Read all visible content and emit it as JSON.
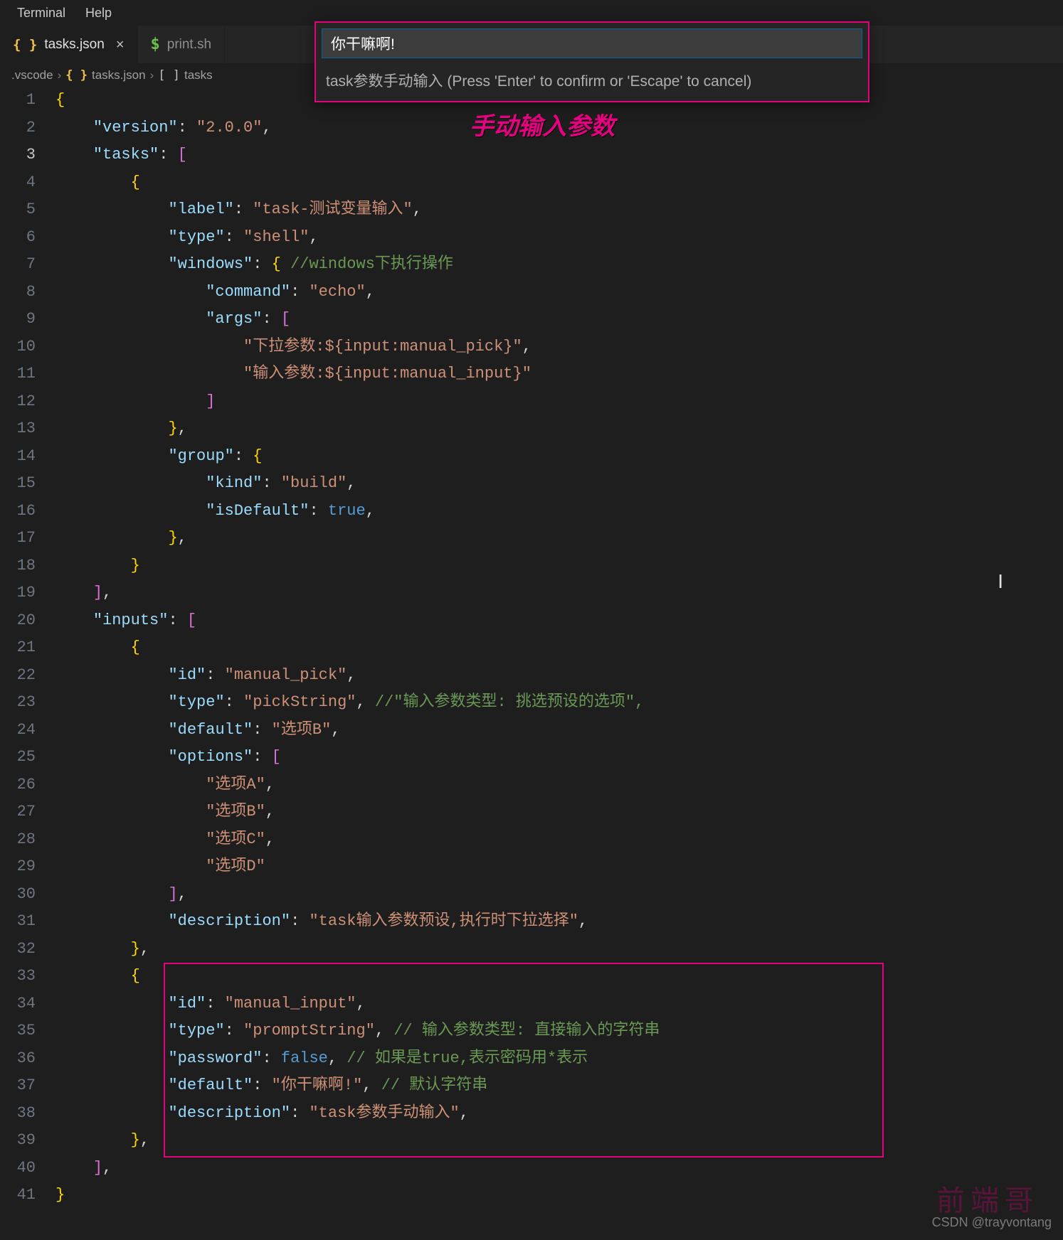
{
  "menubar": {
    "terminal": "Terminal",
    "help": "Help"
  },
  "tabs": [
    {
      "label": "tasks.json",
      "icon": "{ }",
      "active": true,
      "closable": true
    },
    {
      "label": "print.sh",
      "icon": "$",
      "active": false,
      "closable": false
    }
  ],
  "breadcrumbs": {
    "seg1": ".vscode",
    "seg2_icon": "{ }",
    "seg2": "tasks.json",
    "seg3_icon": "[ ]",
    "seg3": "tasks"
  },
  "popup": {
    "value": "你干嘛啊!",
    "hint": "task参数手动输入 (Press 'Enter' to confirm or 'Escape' to cancel)"
  },
  "annotation": "手动输入参数",
  "watermark": "CSDN @trayvontang",
  "watermark2": "前端哥",
  "code": {
    "lines": [
      "{",
      "    \"version\": \"2.0.0\",",
      "    \"tasks\": [",
      "        {",
      "            \"label\": \"task-测试变量输入\",",
      "            \"type\": \"shell\",",
      "            \"windows\": { //windows下执行操作",
      "                \"command\": \"echo\",",
      "                \"args\": [",
      "                    \"下拉参数:${input:manual_pick}\",",
      "                    \"输入参数:${input:manual_input}\"",
      "                ]",
      "            },",
      "            \"group\": {",
      "                \"kind\": \"build\",",
      "                \"isDefault\": true,",
      "            },",
      "        }",
      "    ],",
      "    \"inputs\": [",
      "        {",
      "            \"id\": \"manual_pick\",",
      "            \"type\": \"pickString\", //\"输入参数类型: 挑选预设的选项\",",
      "            \"default\": \"选项B\",",
      "            \"options\": [",
      "                \"选项A\",",
      "                \"选项B\",",
      "                \"选项C\",",
      "                \"选项D\"",
      "            ],",
      "            \"description\": \"task输入参数预设,执行时下拉选择\",",
      "        },",
      "        {",
      "            \"id\": \"manual_input\",",
      "            \"type\": \"promptString\", // 输入参数类型: 直接输入的字符串",
      "            \"password\": false, // 如果是true,表示密码用*表示",
      "            \"default\": \"你干嘛啊!\", // 默认字符串",
      "            \"description\": \"task参数手动输入\",",
      "        },",
      "    ],",
      "}"
    ]
  }
}
